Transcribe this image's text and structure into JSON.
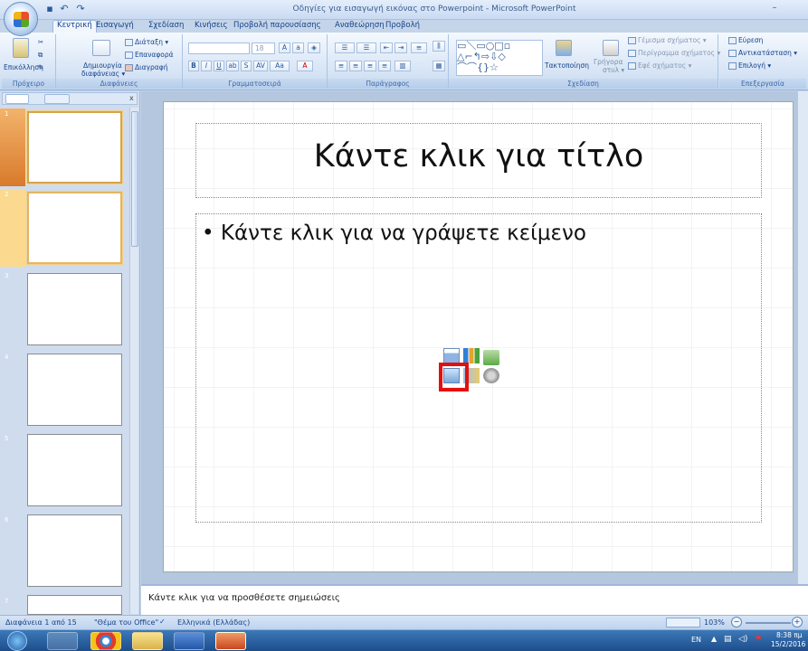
{
  "window": {
    "title": "Οδηγίες για εισαγωγή εικόνας στο Powerpoint - Microsoft PowerPoint",
    "minimize": "–"
  },
  "qat": {
    "save": "save-icon",
    "undo": "↶",
    "redo": "↷"
  },
  "tabs": [
    "Κεντρική",
    "Εισαγωγή",
    "Σχεδίαση",
    "Κινήσεις",
    "Προβολή παρουσίασης",
    "Αναθεώρηση",
    "Προβολή"
  ],
  "ribbon": {
    "clipboard": {
      "paste": "Επικόλληση",
      "label": "Πρόχειρο"
    },
    "slides": {
      "new_slide": "Δημιουργία",
      "new_slide2": "διαφάνειας ▾",
      "layout": "Διάταξη ▾",
      "reset": "Επαναφορά",
      "delete": "Διαγραφή",
      "label": "Διαφάνειες"
    },
    "font": {
      "size": "18",
      "label": "Γραμματοσειρά"
    },
    "paragraph": {
      "label": "Παράγραφος"
    },
    "drawing": {
      "arrange": "Τακτοποίηση",
      "quick_styles": "Γρήγορα",
      "quick_styles2": "στυλ ▾",
      "fill": "Γέμισμα σχήματος ▾",
      "outline": "Περίγραμμα σχήματος ▾",
      "effects": "Εφέ σχήματος ▾",
      "label": "Σχεδίαση"
    },
    "editing": {
      "find": "Εύρεση",
      "replace": "Αντικατάσταση ▾",
      "select": "Επιλογή ▾",
      "label": "Επεξεργασία"
    }
  },
  "thumbnails": [
    "1",
    "2",
    "3",
    "4",
    "5",
    "6",
    "7"
  ],
  "slide": {
    "title": "Κάντε κλικ για τίτλο",
    "body": "Κάντε κλικ για να γράψετε κείμενο"
  },
  "notes": "Κάντε κλικ για να προσθέσετε σημειώσεις",
  "status": {
    "slide": "Διαφάνεια 1 από 15",
    "theme": "\"Θέμα του Office\"",
    "language": "Ελληνικά (Ελλάδας)",
    "zoom": "103%"
  },
  "taskbar": {
    "lang": "EN",
    "time": "8:38 πμ",
    "date": "15/2/2016"
  },
  "colors": {
    "accent": "#e31010",
    "ribbon": "#d6e4f5",
    "taskbar": "#1d4d8b"
  }
}
